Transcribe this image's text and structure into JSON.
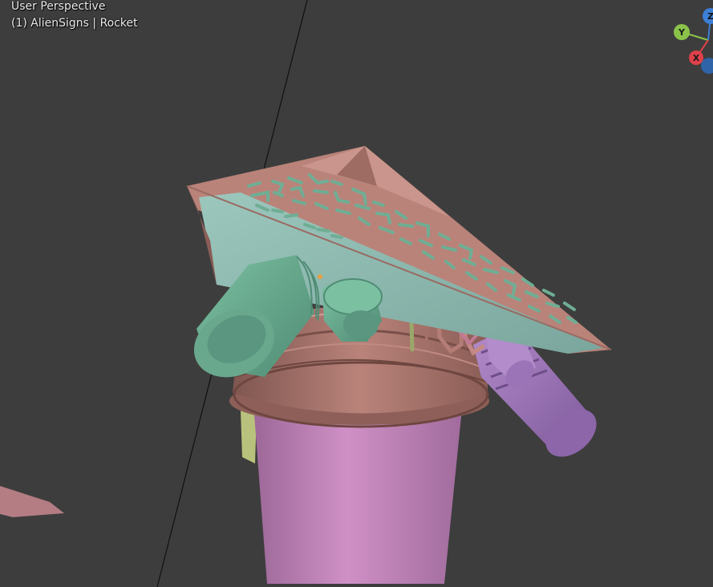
{
  "viewport": {
    "view_name": "User Perspective",
    "object_info": "(1) AlienSigns | Rocket"
  },
  "gizmo": {
    "y_label": "Y",
    "x_label": "X",
    "z_label": "Z",
    "colors": {
      "y": "#8bc34a",
      "x": "#e0404a",
      "z": "#3d7fd6",
      "z_neg": "#2f64a8"
    }
  },
  "colors": {
    "background": "#3d3d3d",
    "copper": "#b9837a",
    "teal_panel": "#8fb9b0",
    "green_engine": "#6fae94",
    "pink_tank": "#c887c0",
    "purple_thruster": "#a47bbf",
    "yellow_green_fin": "#b9c27c"
  }
}
